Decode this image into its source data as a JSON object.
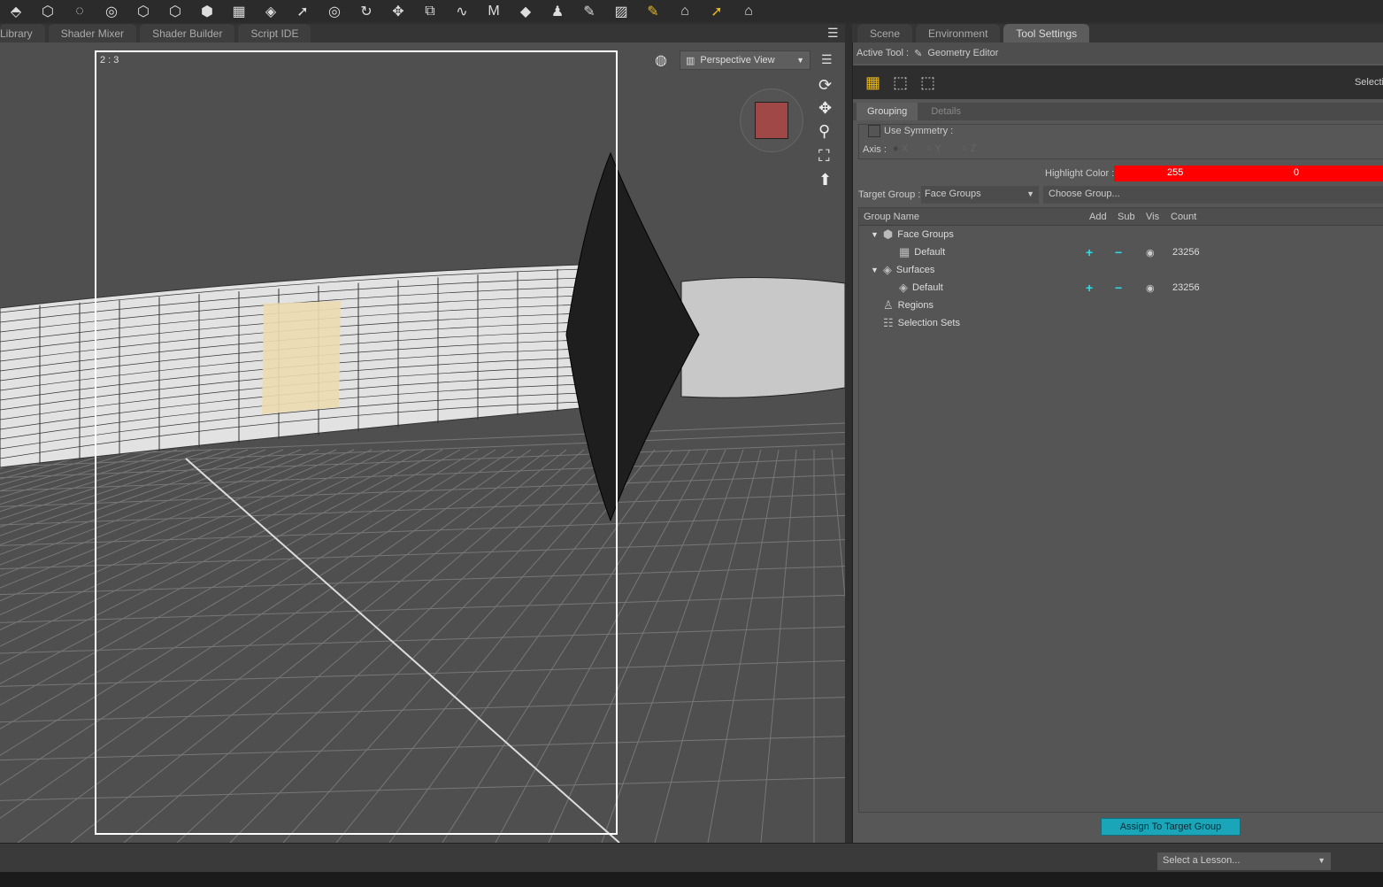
{
  "toolbar": {
    "icons": [
      "node-select-icon",
      "universal-tool-icon",
      "rotate-tool-icon",
      "translate-tool-icon",
      "pose-tool-icon",
      "joint-icon",
      "primitive-icon",
      "grid-icon",
      "orbit-icon",
      "pointer-icon",
      "spin-icon",
      "rotate-icon",
      "move-icon",
      "scale-icon",
      "bone-icon",
      "morph-icon",
      "surface-icon",
      "figure-icon",
      "brush-icon",
      "hatch-icon",
      "geometry-editor-icon",
      "camera-icon",
      "highlight-pointer-icon",
      "render-icon"
    ]
  },
  "left_tabs": [
    "Library",
    "Shader Mixer",
    "Shader Builder",
    "Script IDE"
  ],
  "viewport": {
    "aspect": "2 : 3",
    "view_label": "Perspective View"
  },
  "right_tabs": [
    "Scene",
    "Environment",
    "Tool Settings"
  ],
  "panel": {
    "active_tool_label": "Active Tool :",
    "active_tool": "Geometry Editor",
    "selection_label": "Selecti",
    "sub_tabs": [
      "Grouping",
      "Details"
    ],
    "use_symmetry": "Use Symmetry :",
    "axis_label": "Axis :",
    "axes": [
      "X",
      "Y",
      "Z"
    ],
    "highlight_label": "Highlight Color :",
    "highlight_r": "255",
    "highlight_g": "0",
    "highlight_color": "#ff0000",
    "target_group_label": "Target Group :",
    "target_group": "Face Groups",
    "choose_group": "Choose Group...",
    "columns": [
      "Group Name",
      "Add",
      "Sub",
      "Vis",
      "Count"
    ],
    "tree": [
      {
        "label": "Face Groups",
        "icon": "cube-icon",
        "level": 0,
        "expanded": true
      },
      {
        "label": "Default",
        "icon": "face-group-icon",
        "level": 1,
        "add": "+",
        "sub": "−",
        "count": "23256"
      },
      {
        "label": "Surfaces",
        "icon": "surface-icon",
        "level": 0,
        "expanded": true
      },
      {
        "label": "Default",
        "icon": "surface-icon",
        "level": 1,
        "add": "+",
        "sub": "−",
        "count": "23256"
      },
      {
        "label": "Regions",
        "icon": "region-icon",
        "level": 0
      },
      {
        "label": "Selection Sets",
        "icon": "selection-set-icon",
        "level": 0
      }
    ],
    "assign_button": "Assign To Target Group"
  },
  "status": {
    "lesson": "Select a Lesson..."
  },
  "colors": {
    "accent": "#1aa6b8",
    "highlight": "#ff0000",
    "add_sub": "#29e0e8"
  }
}
